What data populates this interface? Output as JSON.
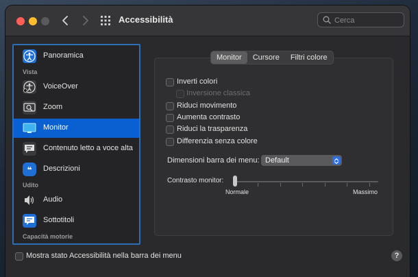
{
  "window": {
    "title": "Accessibilità"
  },
  "search": {
    "placeholder": "Cerca"
  },
  "sidebar": {
    "items": [
      {
        "label": "Panoramica",
        "icon": "accessibility-icon"
      },
      {
        "label": "VoiceOver",
        "icon": "voiceover-icon"
      },
      {
        "label": "Zoom",
        "icon": "zoom-icon"
      },
      {
        "label": "Monitor",
        "icon": "monitor-icon",
        "selected": true
      },
      {
        "label": "Contenuto letto a voce alta",
        "icon": "speech-bubble-icon"
      },
      {
        "label": "Descrizioni",
        "icon": "quote-bubble-icon"
      },
      {
        "label": "Audio",
        "icon": "speaker-icon"
      },
      {
        "label": "Sottotitoli",
        "icon": "captions-icon"
      }
    ],
    "headers": {
      "vista": "Vista",
      "udito": "Udito",
      "motorie": "Capacità motorie"
    }
  },
  "tabs": [
    {
      "label": "Monitor",
      "active": true
    },
    {
      "label": "Cursore"
    },
    {
      "label": "Filtri colore"
    }
  ],
  "options": [
    {
      "label": "Inverti colori",
      "checked": false,
      "disabled": false
    },
    {
      "label": "Inversione classica",
      "checked": false,
      "disabled": true
    },
    {
      "label": "Riduci movimento",
      "checked": false,
      "disabled": false
    },
    {
      "label": "Aumenta contrasto",
      "checked": false,
      "disabled": false
    },
    {
      "label": "Riduci la trasparenza",
      "checked": false,
      "disabled": false
    },
    {
      "label": "Differenzia senza colore",
      "checked": false,
      "disabled": false
    }
  ],
  "menubar_size": {
    "label": "Dimensioni barra dei menu:",
    "value": "Default"
  },
  "contrast": {
    "label": "Contrasto monitor:",
    "min_label": "Normale",
    "max_label": "Massimo",
    "value": 0
  },
  "footer": {
    "show_status_label": "Mostra stato Accessibilità nella barra dei menu",
    "help": "?"
  },
  "colors": {
    "accent": "#0a5fd1",
    "selection_border": "#2d6fb5"
  }
}
